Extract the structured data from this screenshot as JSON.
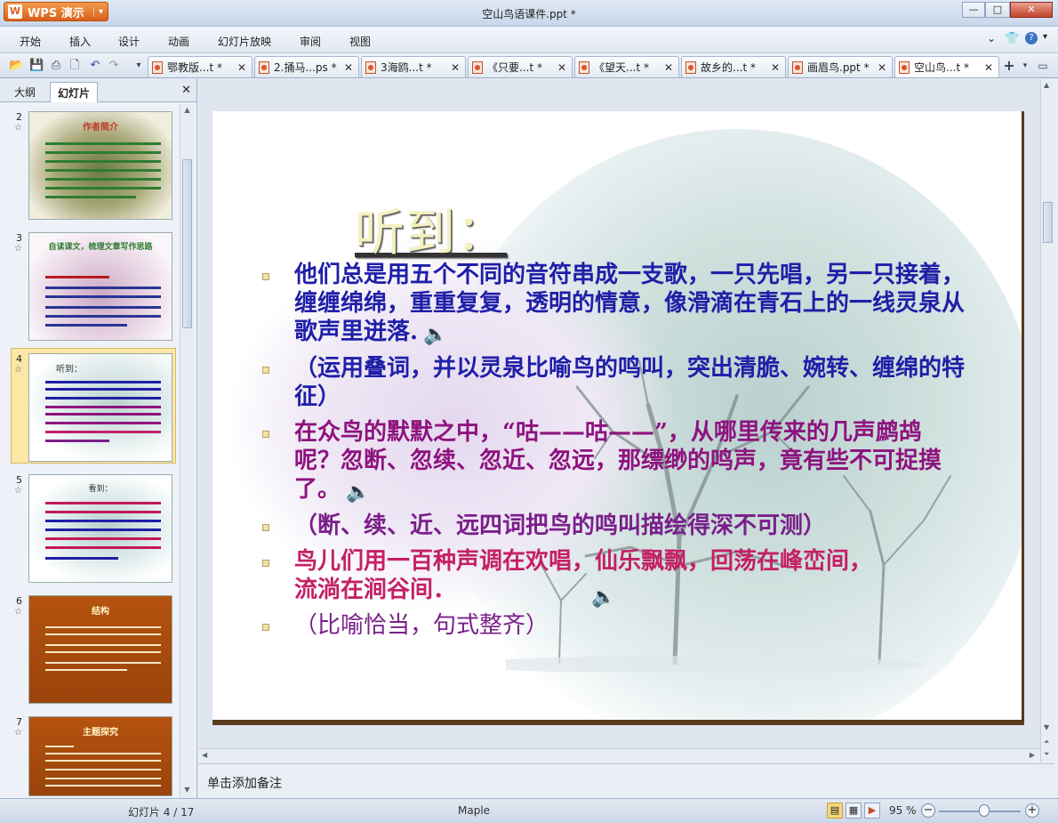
{
  "app": {
    "button_label": "WPS 演示",
    "window_title": "空山鸟语课件.ppt *"
  },
  "menu": [
    "开始",
    "插入",
    "设计",
    "动画",
    "幻灯片放映",
    "审阅",
    "视图"
  ],
  "doc_tabs": [
    {
      "label": "鄂教版...t *",
      "active": false
    },
    {
      "label": "2.捅马...ps *",
      "active": false
    },
    {
      "label": "3海鸥...t *",
      "active": false
    },
    {
      "label": "《只要...t *",
      "active": false
    },
    {
      "label": "《望天...t *",
      "active": false
    },
    {
      "label": "故乡的...t *",
      "active": false
    },
    {
      "label": "画眉鸟.ppt *",
      "active": false
    },
    {
      "label": "空山鸟...t *",
      "active": true
    }
  ],
  "side_panel": {
    "tabs": [
      "大纲",
      "幻灯片"
    ],
    "active_tab": "幻灯片",
    "slides": [
      {
        "num": "2",
        "title": "作者简介"
      },
      {
        "num": "3",
        "title": "自读课文，梳理文章写作思路"
      },
      {
        "num": "4",
        "title": "听到："
      },
      {
        "num": "5",
        "title": "看到："
      },
      {
        "num": "6",
        "title": "结构"
      },
      {
        "num": "7",
        "title": "主题探究"
      }
    ],
    "selected_index": 2
  },
  "slide": {
    "heading": "听到：",
    "bullets": [
      {
        "text": "他们总是用五个不同的音符串成一支歌，一只先唱，另一只接着，缠缠绵绵，重重复复，透明的情意，像滑滴在青石上的一线灵泉从歌声里迸落.",
        "color": "#1f1fa8",
        "has_sound": true
      },
      {
        "text": "（运用叠词，并以灵泉比喻鸟的鸣叫，突出清脆、婉转、缠绵的特征）",
        "color": "#1f1fa8",
        "has_sound": false
      },
      {
        "text": "在众鸟的默默之中，“咕——咕——”，从哪里传来的几声鹧鸪呢？忽断、忽续、忽近、忽远，那缥缈的鸣声，竟有些不可捉摸了。",
        "color": "#8e137e",
        "has_sound": true
      },
      {
        "text": "（断、续、近、远四词把鸟的鸣叫描绘得深不可测）",
        "color": "#8e137e",
        "has_sound": false
      },
      {
        "text": "鸟儿们用一百种声调在欢唱，仙乐飘飘，回荡在峰峦间，流淌在涧谷间．",
        "color": "#c42066",
        "has_sound": true
      },
      {
        "text": "（比喻恰当，句式整齐）",
        "color": "#7a1f8a",
        "has_sound": false
      }
    ]
  },
  "notes_placeholder": "单击添加备注",
  "status": {
    "slide_counter": "幻灯片 4 / 17",
    "theme": "Maple",
    "zoom": "95 %",
    "zoom_fraction": 0.55
  }
}
